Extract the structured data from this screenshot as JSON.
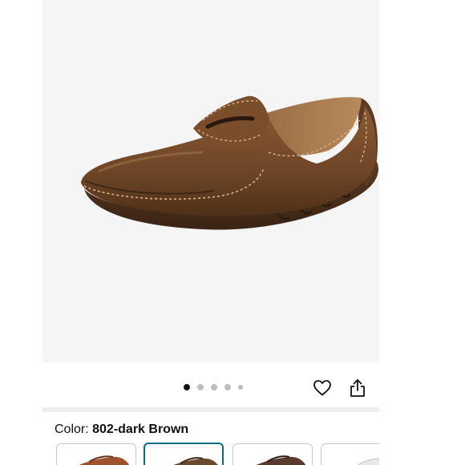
{
  "gallery": {
    "image_count": 5,
    "active_index": 0
  },
  "icons": {
    "wishlist": "heart-icon",
    "share": "share-icon"
  },
  "variation": {
    "label": "Color:",
    "selected_value": "802-dark Brown",
    "swatches": [
      {
        "color": "#a0522d",
        "selected": false
      },
      {
        "color": "#6b4a2e",
        "selected": true
      },
      {
        "color": "#5a3a2e",
        "selected": false
      },
      {
        "color": "#e8e8e8",
        "selected": false
      }
    ]
  },
  "colors": {
    "accent": "#007185",
    "active_dot": "#111111",
    "inactive_dot": "#bdbdbd",
    "image_background": "#f5f5f5"
  }
}
